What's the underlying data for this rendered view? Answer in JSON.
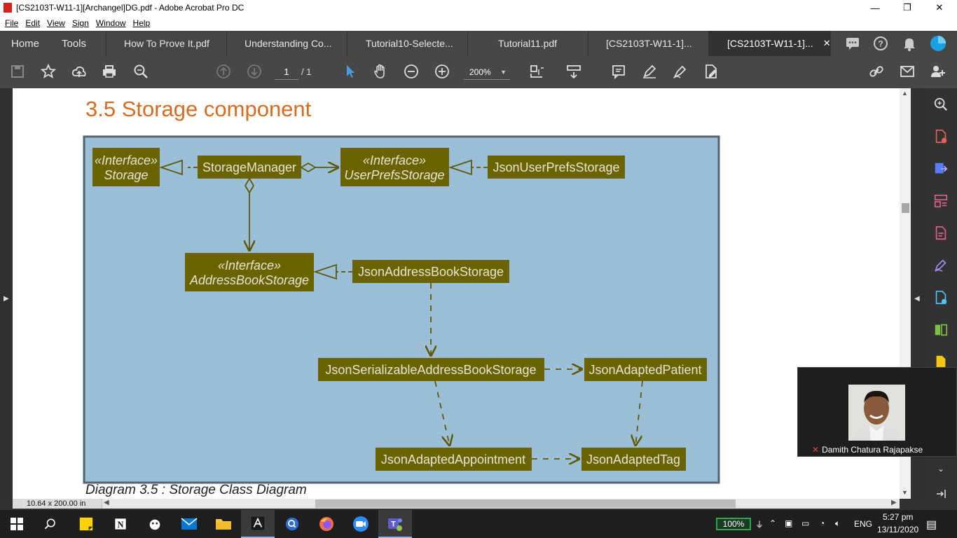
{
  "window": {
    "title": "[CS2103T-W11-1][Archangel]DG.pdf - Adobe Acrobat Pro DC",
    "minimize": "—",
    "restore": "❐",
    "close": "✕"
  },
  "menu": [
    "File",
    "Edit",
    "View",
    "Sign",
    "Window",
    "Help"
  ],
  "tabs": {
    "home": "Home",
    "tools": "Tools",
    "docs": [
      "How To Prove It.pdf",
      "Understanding Co...",
      "Tutorial10-Selecte...",
      "Tutorial11.pdf",
      "[CS2103T-W11-1]...",
      "[CS2103T-W11-1]..."
    ],
    "close": "✕"
  },
  "toolbar": {
    "page_current": "1",
    "page_total": "/ 1",
    "zoom": "200%"
  },
  "document": {
    "heading": "3.5 Storage component",
    "caption": "Diagram 3.5 : Storage Class Diagram",
    "size_indicator": "10.64 x 200.00 in"
  },
  "diagram": {
    "fill": "#6b6300",
    "background": "#9bbfd8",
    "line": "#5f5a00",
    "text_color": "#e4e4d4",
    "storage_stereo": "«Interface»",
    "storage_name": "Storage",
    "storage_manager": "StorageManager",
    "userprefs_stereo": "«Interface»",
    "userprefs_name": "UserPrefsStorage",
    "json_userprefs": "JsonUserPrefsStorage",
    "addressbook_stereo": "«Interface»",
    "addressbook_name": "AddressBookStorage",
    "json_addressbook": "JsonAddressBookStorage",
    "json_serializable": "JsonSerializableAddressBookStorage",
    "json_patient": "JsonAdaptedPatient",
    "json_appointment": "JsonAdaptedAppointment",
    "json_tag": "JsonAdaptedTag"
  },
  "teams": {
    "participant": "Damith Chatura Rajapakse"
  },
  "taskbar": {
    "battery": "100%",
    "language": "ENG",
    "time": "5:27 pm",
    "date": "13/11/2020"
  }
}
